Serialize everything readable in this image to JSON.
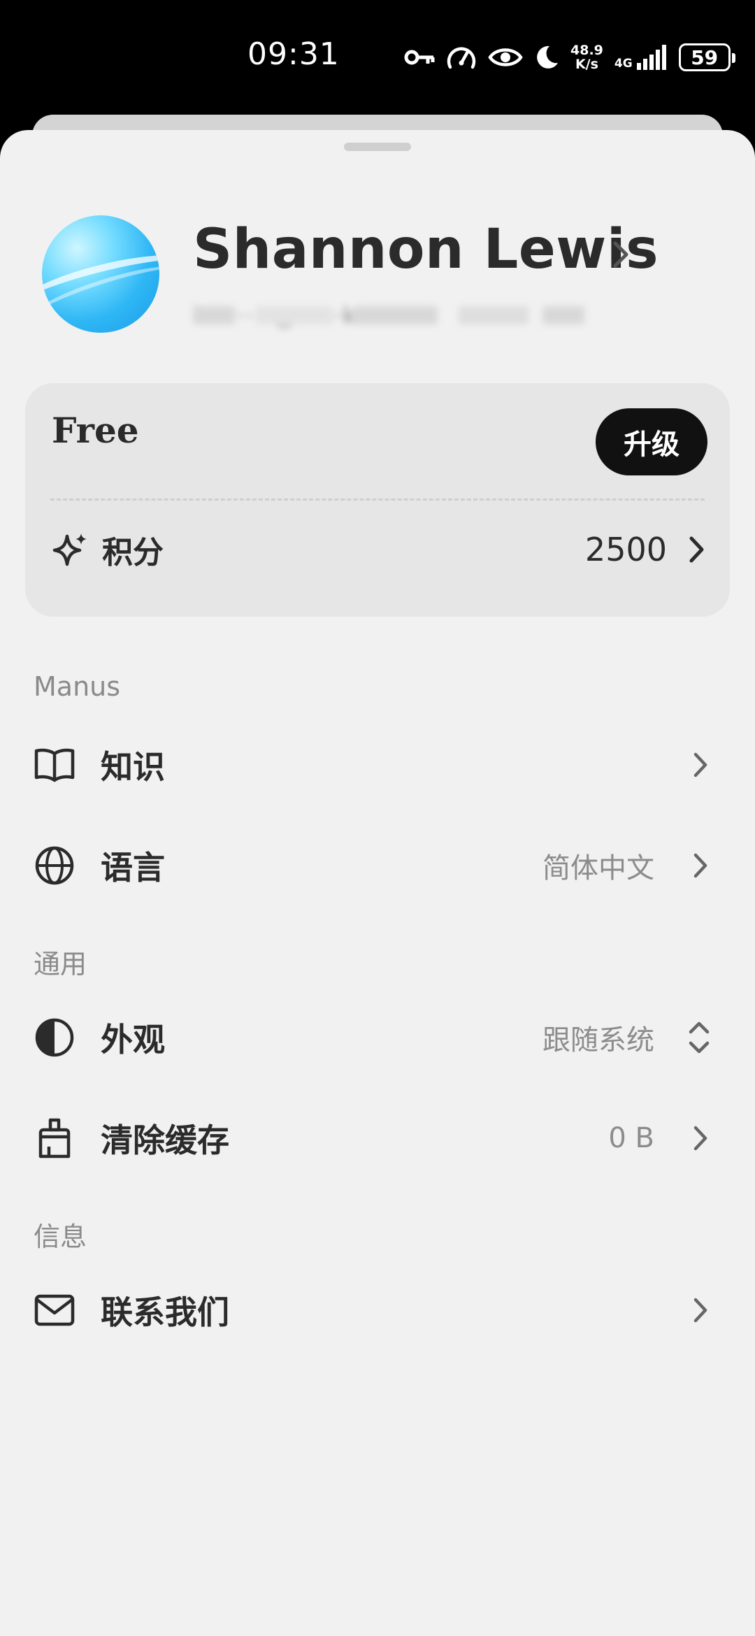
{
  "status_bar": {
    "time": "09:31",
    "net_speed_top": "48.9",
    "net_speed_bottom": "K/s",
    "network": "4G",
    "battery": "59",
    "icons": [
      "vpn-key-icon",
      "speedometer-icon",
      "eye-icon",
      "moon-icon",
      "signal-icon",
      "battery-icon"
    ]
  },
  "profile": {
    "name": "Shannon Lewis",
    "email_obscured": "bra····@·····k.com"
  },
  "plan": {
    "name": "Free",
    "upgrade_label": "升级",
    "credits_label": "积分",
    "credits_value": "2500"
  },
  "sections": {
    "manus": {
      "label": "Manus",
      "items": [
        {
          "label": "知识",
          "value": "",
          "icon": "book-icon"
        },
        {
          "label": "语言",
          "value": "简体中文",
          "icon": "globe-icon"
        }
      ]
    },
    "general": {
      "label": "通用",
      "items": [
        {
          "label": "外观",
          "value": "跟随系统",
          "icon": "contrast-icon"
        },
        {
          "label": "清除缓存",
          "value": "0 B",
          "icon": "brush-icon"
        }
      ]
    },
    "info": {
      "label": "信息",
      "items": [
        {
          "label": "联系我们",
          "value": "",
          "icon": "mail-icon"
        }
      ]
    }
  },
  "colors": {
    "sheet_background": "#f1f1f1",
    "card_background": "#e6e6e6",
    "button_background": "#111111",
    "text_primary": "#2b2b2b",
    "text_secondary": "#8a8a8a"
  }
}
